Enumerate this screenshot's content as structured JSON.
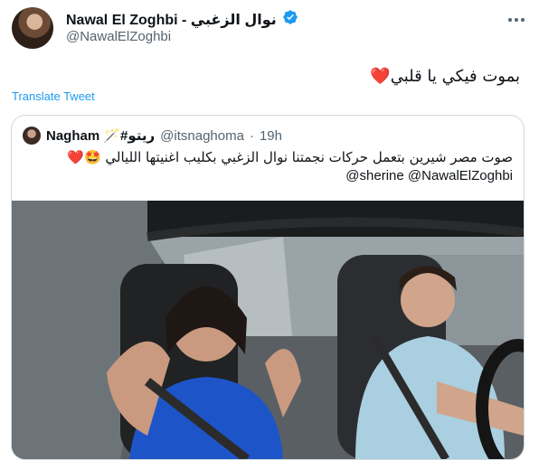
{
  "tweet": {
    "display_name": "Nawal El Zoghbi - نوال الزغبي",
    "handle": "@NawalElZoghbi",
    "text": "بموت فيكي يا قلبي❤️",
    "translate_label": "Translate Tweet",
    "verified_icon": "verified-badge-icon",
    "more_icon": "more-dots-icon",
    "accent_color": "#1d9bf0"
  },
  "quote": {
    "display_name": "Nagham 🪄#ريتو",
    "handle": "@itsnaghoma",
    "separator": "·",
    "time": "19h",
    "text": "صوت مصر شيرين  بتعمل حركات نجمتنا  نوال الزغبي بكليب اغنيتها الليالي 🤩❤️",
    "mentions": "@sherine @NawalElZoghbi",
    "media": "video"
  }
}
